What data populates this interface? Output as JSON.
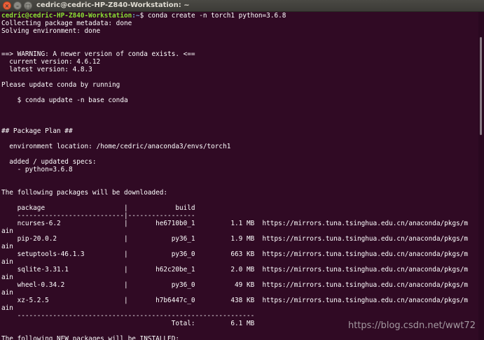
{
  "window": {
    "title": "cedric@cedric-HP-Z840-Workstation: ~",
    "close_glyph": "×",
    "minimize_glyph": "–",
    "maximize_glyph": "□"
  },
  "prompt": {
    "user_host": "cedric@cedric-HP-Z840-Workstation",
    "path": ":~",
    "symbol": "$ ",
    "command": "conda create -n torch1 python=3.6.8"
  },
  "terminal_lines": [
    "Collecting package metadata: done",
    "Solving environment: done",
    "",
    "",
    "==> WARNING: A newer version of conda exists. <==",
    "  current version: 4.6.12",
    "  latest version: 4.8.3",
    "",
    "Please update conda by running",
    "",
    "    $ conda update -n base conda",
    "",
    "",
    "",
    "## Package Plan ##",
    "",
    "  environment location: /home/cedric/anaconda3/envs/torch1",
    "",
    "  added / updated specs:",
    "    - python=3.6.8",
    "",
    "",
    "The following packages will be downloaded:",
    "",
    "    package                    |            build",
    "    ---------------------------|-----------------",
    "    ncurses-6.2                |       he6710b0_1         1.1 MB  https://mirrors.tuna.tsinghua.edu.cn/anaconda/pkgs/m",
    "ain",
    "    pip-20.0.2                 |           py36_1         1.9 MB  https://mirrors.tuna.tsinghua.edu.cn/anaconda/pkgs/m",
    "ain",
    "    setuptools-46.1.3          |           py36_0         663 KB  https://mirrors.tuna.tsinghua.edu.cn/anaconda/pkgs/m",
    "ain",
    "    sqlite-3.31.1              |       h62c20be_1         2.0 MB  https://mirrors.tuna.tsinghua.edu.cn/anaconda/pkgs/m",
    "ain",
    "    wheel-0.34.2               |           py36_0          49 KB  https://mirrors.tuna.tsinghua.edu.cn/anaconda/pkgs/m",
    "ain",
    "    xz-5.2.5                   |       h7b6447c_0         438 KB  https://mirrors.tuna.tsinghua.edu.cn/anaconda/pkgs/m",
    "ain",
    "    ------------------------------------------------------------",
    "                                           Total:         6.1 MB",
    "",
    "The following NEW packages will be INSTALLED:"
  ],
  "watermark": "https://blog.csdn.net/wwt72"
}
